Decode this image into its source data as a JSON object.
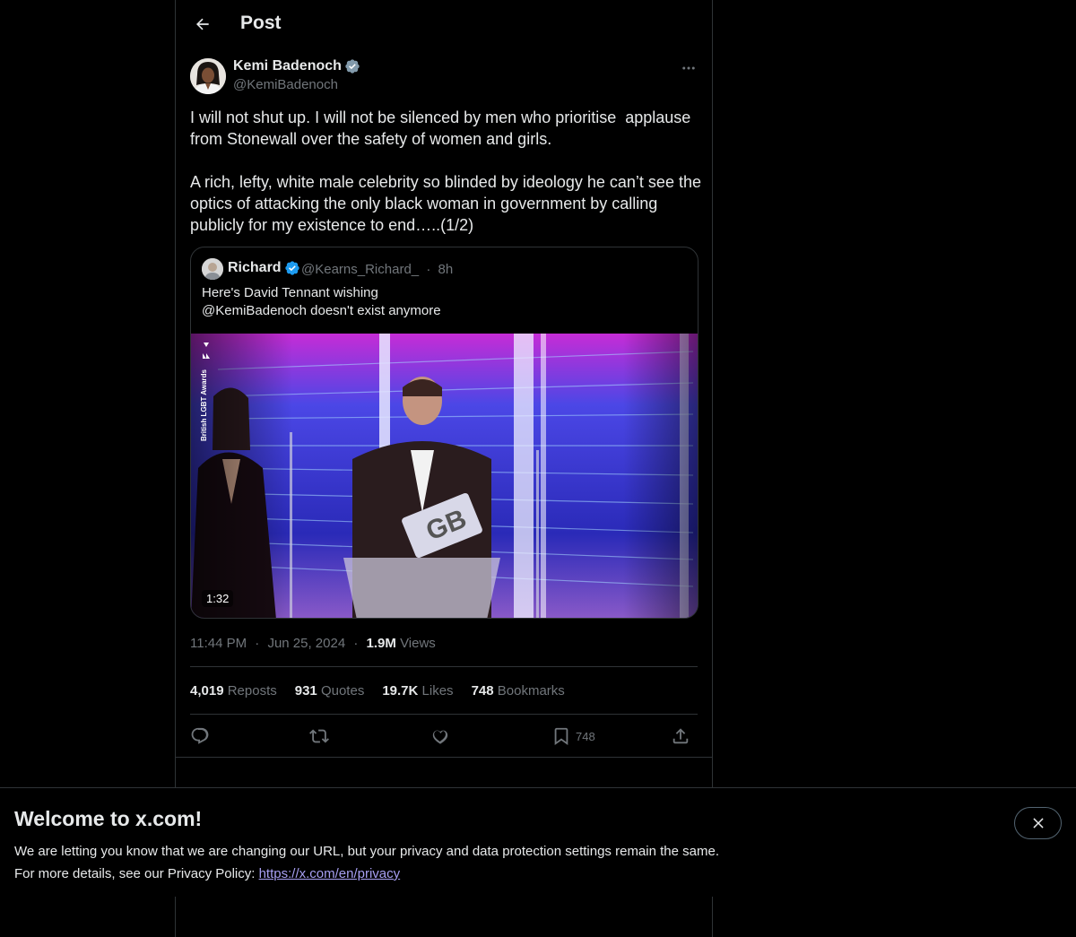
{
  "header": {
    "title": "Post"
  },
  "author": {
    "name": "Kemi Badenoch",
    "handle": "@KemiBadenoch",
    "verified": true
  },
  "tweet": {
    "text": "I will not shut up. I will not be silenced by men who prioritise  applause\nfrom Stonewall over the safety of women and girls.\n\nA rich, lefty, white male celebrity so blinded by ideology he can’t see the\noptics of attacking the only black woman in government by calling\npublicly for my existence to end…..(1/2)"
  },
  "quote": {
    "name": "Richard",
    "handle": "@Kearns_Richard_",
    "separator": "·",
    "age": "8h",
    "text": "Here's David Tennant wishing\n@KemiBadenoch doesn't exist anymore",
    "duration": "1:32",
    "watermark": "British LGBT Awards"
  },
  "meta": {
    "time": "11:44 PM",
    "date": "Jun 25, 2024",
    "views_count": "1.9M",
    "views_label": "Views",
    "dot": "·"
  },
  "stats": [
    {
      "count": "4,019",
      "label": "Reposts"
    },
    {
      "count": "931",
      "label": "Quotes"
    },
    {
      "count": "19.7K",
      "label": "Likes"
    },
    {
      "count": "748",
      "label": "Bookmarks"
    }
  ],
  "actions": {
    "bookmark_count": "748"
  },
  "banner": {
    "title": "Welcome to x.com!",
    "line1": "We are letting you know that we are changing our URL, but your privacy and data protection settings remain the same.",
    "line2_prefix": "For more details, see our Privacy Policy: ",
    "link": "https://x.com/en/privacy"
  },
  "colors": {
    "background": "#000000",
    "text": "#e7e9ea",
    "muted": "#71767b",
    "border": "#2f3336",
    "verified": "#1d9bf0",
    "link": "#a79ff2"
  }
}
